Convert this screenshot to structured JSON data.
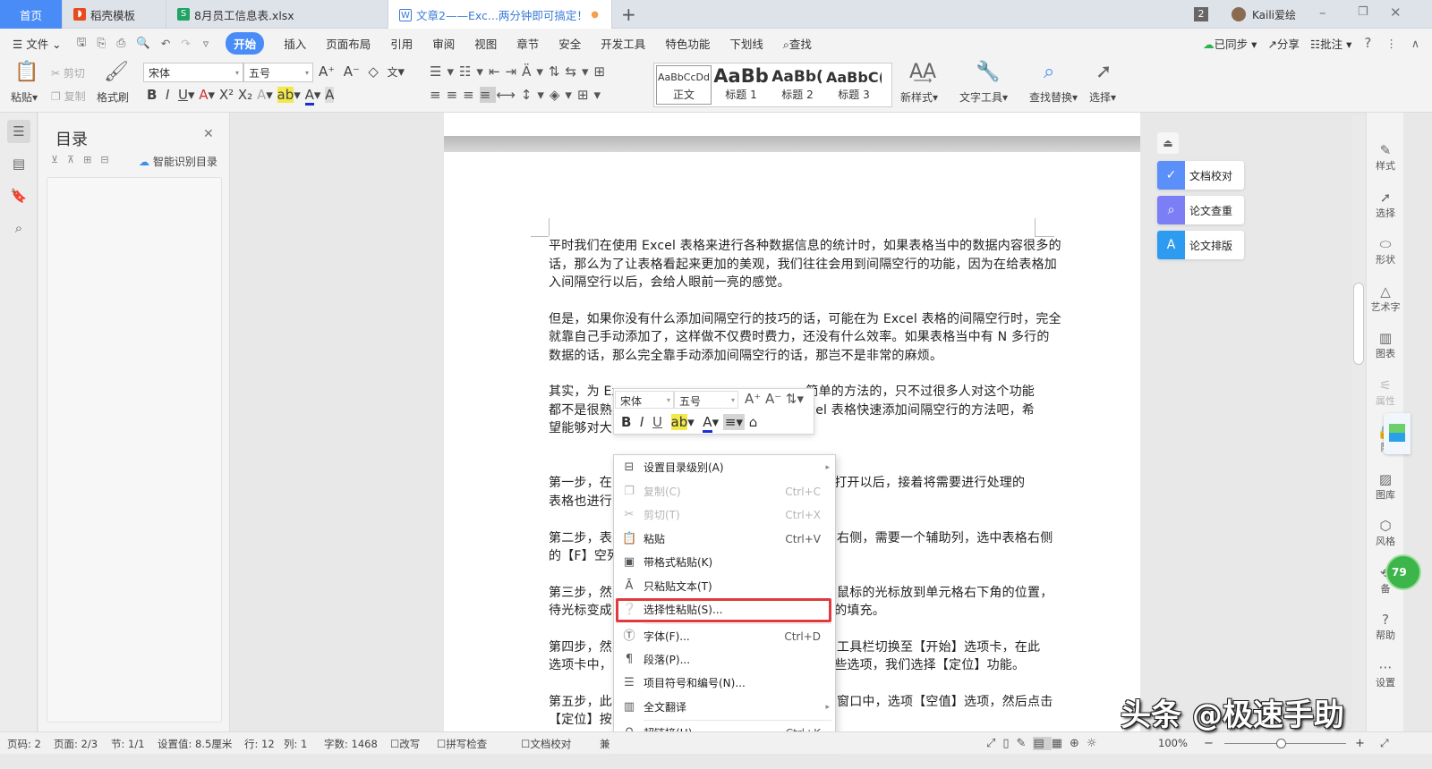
{
  "tabs": [
    {
      "label": "首页",
      "active": true
    },
    {
      "label": "稻壳模板"
    },
    {
      "label": "8月员工信息表.xlsx"
    },
    {
      "label": "文章2——Exc...两分钟即可搞定！"
    }
  ],
  "titlebar": {
    "badge": "2",
    "user": "Kaili爱绘"
  },
  "menu": {
    "file": "文件",
    "items": [
      "开始",
      "插入",
      "页面布局",
      "引用",
      "审阅",
      "视图",
      "章节",
      "安全",
      "开发工具",
      "特色功能",
      "下划线"
    ],
    "search": "查找",
    "sync": "已同步",
    "share": "分享",
    "comment": "批注"
  },
  "ribbon": {
    "paste": "粘贴",
    "cut": "剪切",
    "copy": "复制",
    "format_painter": "格式刷",
    "font": "宋体",
    "size": "五号",
    "styles": [
      {
        "preview": "AaBbCcDd",
        "name": "正文"
      },
      {
        "preview": "AaBb",
        "name": "标题 1"
      },
      {
        "preview": "AaBb(",
        "name": "标题 2"
      },
      {
        "preview": "AaBbC(",
        "name": "标题 3"
      }
    ],
    "new_style": "新样式",
    "text_tools": "文字工具",
    "find_replace": "查找替换",
    "select": "选择"
  },
  "toc": {
    "title": "目录",
    "smart": "智能识别目录"
  },
  "document": {
    "lines": [
      [
        "平时我们在使用 Excel 表格来进行各种数据信息的统计时，如果表格当中的数据内容很多的",
        ""
      ],
      [
        "话，那么为了让表格看起来更加的美观，我们往往会用到间隔空行的功能，因为在给表格加",
        ""
      ],
      [
        "入间隔空行以后，会给人眼前一亮的感觉。",
        ""
      ],
      [
        "但是，如果你没有什么添加间隔空行的技巧的话，可能在为 Excel 表格的间隔空行时，完全",
        ""
      ],
      [
        "就靠自己手动添加了，这样做不仅费时费力，还没有什么效率。如果表格当中有 N 多行的",
        ""
      ],
      [
        "数据的话，那么完全靠手动添加间隔空行的话，那岂不是非常的麻烦。",
        ""
      ],
      [
        "其实，为 Ex",
        "简单的方法的，只不过很多人对这个功能"
      ],
      [
        "都不是很熟",
        "xcel 表格快速添加间隔空行的方法吧，希"
      ],
      [
        "望能够对大",
        ""
      ],
      [
        "第一步，在",
        "序打开以后，接着将需要进行处理的"
      ],
      [
        "表格也进行",
        ""
      ],
      [
        "第二步，表",
        "右侧，需要一个辅助列，选中表格右侧"
      ],
      [
        "的【F】空列",
        ""
      ],
      [
        "第三步，然",
        "鼠标的光标放到单元格右下角的位置，"
      ],
      [
        "待光标变成",
        "下的填充。"
      ],
      [
        "第四步，然",
        "工具栏切换至【开始】选项卡，在此"
      ],
      [
        "选项卡中，",
        "一些选项，我们选择【定位】功能。"
      ],
      [
        "第五步，此",
        "窗口中，选项【空值】选项，然后点击"
      ],
      [
        "【定位】按",
        ""
      ]
    ]
  },
  "mini_toolbar": {
    "font": "宋体",
    "size": "五号"
  },
  "context_menu": {
    "items": [
      {
        "icon": "toc-level-icon",
        "label": "设置目录级别(A)",
        "submenu": true
      },
      {
        "icon": "copy-icon",
        "label": "复制(C)",
        "shortcut": "Ctrl+C",
        "disabled": true
      },
      {
        "icon": "cut-icon",
        "label": "剪切(T)",
        "shortcut": "Ctrl+X",
        "disabled": true
      },
      {
        "icon": "paste-icon",
        "label": "粘贴",
        "shortcut": "Ctrl+V"
      },
      {
        "icon": "paste-format-icon",
        "label": "带格式粘贴(K)"
      },
      {
        "icon": "paste-text-icon",
        "label": "只粘贴文本(T)"
      },
      {
        "icon": "paste-special-icon",
        "label": "选择性粘贴(S)...",
        "highlighted": true
      },
      {
        "icon": "font-icon",
        "label": "字体(F)...",
        "shortcut": "Ctrl+D"
      },
      {
        "icon": "paragraph-icon",
        "label": "段落(P)..."
      },
      {
        "icon": "list-icon",
        "label": "项目符号和编号(N)..."
      },
      {
        "icon": "translate-icon",
        "label": "全文翻译",
        "submenu": true
      },
      {
        "icon": "link-icon",
        "label": "超链接(H)...",
        "shortcut": "Ctrl+K"
      }
    ],
    "highlight_color": "#e0393e"
  },
  "right_panel": [
    {
      "label": "文档校对",
      "color": "#5b8ff9"
    },
    {
      "label": "论文查重",
      "color": "#7b7ef5"
    },
    {
      "label": "论文排版",
      "color": "#2d9cf0"
    }
  ],
  "right_bar": [
    "样式",
    "选择",
    "形状",
    "艺术字",
    "图表",
    "属性",
    "限",
    "图库",
    "风格",
    "备",
    "帮助",
    "设置"
  ],
  "badge_79": "79",
  "status": {
    "page": "页码: 2",
    "pages": "页面: 2/3",
    "section": "节: 1/1",
    "setting": "设置值: 8.5厘米",
    "row": "行: 12",
    "col": "列: 1",
    "words": "字数: 1468",
    "overwrite": "改写",
    "spell": "拼写检查",
    "proof": "文档校对",
    "compat": "兼",
    "zoom": "100%",
    "zoom_percent": 100
  },
  "watermark": "头条 @极速手助",
  "colors": {
    "accent": "#4a8cf7"
  }
}
